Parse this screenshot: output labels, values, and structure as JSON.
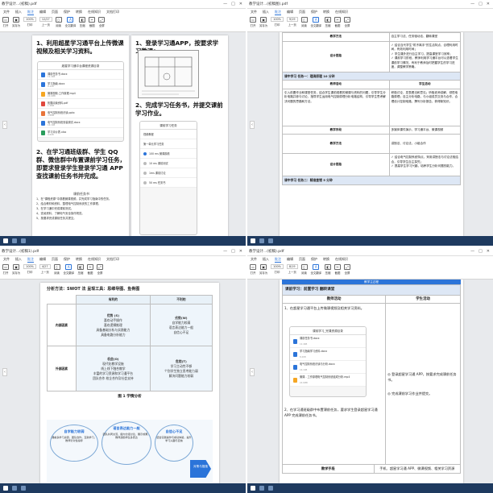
{
  "window": {
    "controls": [
      "—",
      "□",
      "✕"
    ]
  },
  "panes": [
    {
      "title": "教学设计...(初稿).pdf",
      "menu": [
        "文件",
        "插入",
        "批注",
        "编辑",
        "页面",
        "保护",
        "转换",
        "在线知识",
        "文档打印"
      ],
      "active_menu": "批注",
      "zoom": "100%",
      "page": "12/27",
      "toolbar": [
        "打开",
        "另存为",
        "打印",
        "导出",
        "查找",
        "高亮",
        "文字",
        "手型",
        "选择",
        "上一页",
        "下一页",
        "阅读",
        "全文翻译",
        "压缩",
        "截图",
        "全屏"
      ],
      "heading1": "1、利用超星学习通平台上传微课视频及相关学习资料。",
      "heading2": "2、在学习通班级群、学生 QQ 群、微信群中布置课前学习任务，即要求登录学生登录学习通 APP 查找课前任务书并完成。",
      "phone1_title": "超星学习通平台课程资源目录",
      "files": [
        {
          "name": "课前任务书.docx",
          "sub": "12.4KB"
        },
        {
          "name": "学习指南.docx",
          "sub": "8.2KB"
        },
        {
          "name": "微课视频-工作原理.mp4",
          "sub": "24.6MB"
        },
        {
          "name": "拓展阅读资料.pdf",
          "sub": "1.2MB"
        },
        {
          "name": "电气控制系统识读.pptx",
          "sub": "3.8MB"
        },
        {
          "name": "电气控制系统安装调试.docx",
          "sub": "16.1KB"
        },
        {
          "name": "学习评价表.xlsx",
          "sub": "9.6KB"
        }
      ],
      "right_h1": "1、登录学习通APP，按要求学习微课；",
      "right_h2": "2、完成学习任务书，并提交课前学习作业。",
      "task_title": "课前任务书",
      "task_lines": [
        "1、在\"课程资源\"中观看微课视频，并完成学习指南中的任务。",
        "2、结合教材和资料，整理电气控制系统的工作原理。",
        "3、在学习通中完成课前测试。",
        "4、查阅资料，了解电气安全操作规范。",
        "5、按要求完成课前任务并提交。"
      ],
      "phone2_title": "课前学习任务",
      "phone2_rows": [
        "视频教程",
        "第一单元学习任务",
        "100 ms 微课观看",
        "10 ms 课前测试",
        "1ms 课前讨论",
        "50 ms 任务书"
      ]
    },
    {
      "title": "教学设计...(初稿图).pdf",
      "page": "9/19",
      "rows": [
        {
          "label": "教学方法",
          "content": "自主学习法、任务驱动法、翻转课堂"
        },
        {
          "label": "设计思路",
          "items": [
            "结合当代学生\"机不离手\"的生活特点、合理利用时间，有效利用时间；",
            "学生课外进行自主学习，提高课堂学习效率；",
            "课前学习阶段，教师利用学习通平台可以查看学生课前学习情况，有利于教师及时把握学生的学习进度，调整教学策略。"
          ]
        },
        {
          "label": "课中学习",
          "content": "任务一：理清原理 10 分钟",
          "head": true
        },
        {
          "label": "",
          "col1": "教师活动",
          "col2": "学生活动",
          "colhead": true
        },
        {
          "label": "",
          "col1": "引入前置作业和课堂任务，结合学生课前观看的微课与资料的问题，引导学生分析电路并参与讨论，指导学生运用电气控制原理分析电路结构，引导学生思考解决问题的思路和方法。",
          "col2": "积极讨论，发表看法和意见；听取老师讲解，领悟电路原理；自主分析电路，与小组成员交流与合作，合理设计控制电路，撰写分析报告，获得新知识。"
        },
        {
          "label": "教学手段",
          "content": "多媒体课件演示、学习通平台、微课视频"
        },
        {
          "label": "教学方法",
          "content": "讲授法、讨论法、小组合作"
        },
        {
          "label": "设计思路",
          "items": [
            "结合电气控制系统特点，采用讲授法与讨论法相结合，引导学生自主探究；",
            "提高学生学习兴趣，培养学生分析问题的能力。"
          ]
        },
        {
          "label": "课中学习",
          "content": "任务二：精准查错 5 分钟",
          "head": true
        }
      ]
    },
    {
      "title": "教学设计...(初稿1).pdf",
      "page": "4/27",
      "heading": "分析方法：SWOT 法    呈现工具：思维导图、鱼骨图",
      "col_good": "有利的",
      "col_bad": "不利的",
      "inner_label": "内部因素",
      "outer_label": "外部因素",
      "s_title": "优势 (S)",
      "s_items": [
        "喜欢动手操作",
        "喜欢逻辑推理",
        "具备基础分析与实践能力",
        "具备电路分析能力"
      ],
      "w_title": "劣势(W)",
      "w_items": [
        "自学能力较弱",
        "语言表达能力一般",
        "自信心不足"
      ],
      "o_title": "机会(O)",
      "o_items": [
        "现代化教学设施",
        "线上线下融合教学",
        "丰富的学习资源和学习通平台",
        "团队合作 校企合作及社会支持"
      ],
      "t_title": "危险(T)",
      "t_items": [
        "学习主动性不够",
        "个别学生独立思考能力弱",
        "解决问题能力较弱"
      ],
      "caption": "图 1  学情分析",
      "bubbles": [
        {
          "title": "自学能力较弱",
          "text": "课前多学习资源，团队合作，互助学习，教师针对性指导"
        },
        {
          "title": "语言表达能力一般",
          "text": "团队共同交流，组内分组讨论，展示成果，教师鼓励学生多表达"
        },
        {
          "title": "自信心不足",
          "text": "结合实践操作与成功体验，提升学习兴趣与自信"
        }
      ],
      "arrow_text": "对策与措施"
    },
    {
      "title": "教学设计...(初稿).pdf",
      "page": "8/19",
      "top_strip": "教学主过程",
      "section": "课前学习：前置学习  翻转课堂",
      "col_teacher": "教师活动",
      "col_student": "学生活动",
      "t1": "1、在超星学习通平台上传微课视频及相关学习资料。",
      "t2": "2、在学习通班级群中布置课前任务，要求学生登录超星学习通 APP 完成课前任务书。",
      "s1": "登录超星学习通 APP，按要求完成课前任务书。",
      "s2": "完成课前学习作业并提交。",
      "phone_title": "课前学习_完课资源目录",
      "files": [
        {
          "name": "课前任务书.docx",
          "sub": "12.4KB"
        },
        {
          "name": "学习指南学习资料.docx",
          "sub": "8.2KB"
        },
        {
          "name": "电气控制系统识读与分析.docx",
          "sub": "16.1KB"
        },
        {
          "name": "微课 - 工作原理电气控制系统组成分析.mp4",
          "sub": "24.6MB"
        }
      ],
      "bottom_label": "教学手段",
      "bottom_text": "手机、超星学习通 APP、微课视频、相关学习资源"
    }
  ]
}
